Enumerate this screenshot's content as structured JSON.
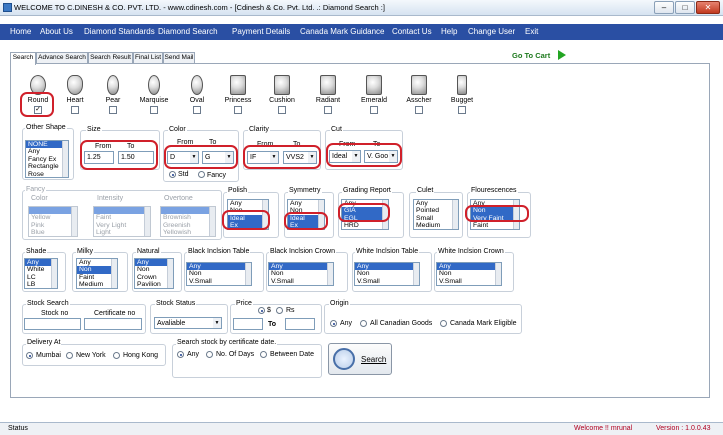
{
  "window": {
    "title": "WELCOME TO C.DINESH & CO. PVT. LTD. - www.cdinesh.com - [Cdinesh & Co. Pvt. Ltd. .: Diamond Search :]"
  },
  "menu": [
    "Home",
    "About Us",
    "Diamond Standards",
    "Diamond Search",
    "Payment Details",
    "Canada Mark Guidance",
    "Contact Us",
    "Help",
    "Change User",
    "Exit"
  ],
  "tabs": [
    "Search",
    "Advance Search",
    "Search Result",
    "Final List",
    "Send Mail"
  ],
  "go_to_cart": "Go To Cart",
  "shapes": [
    {
      "label": "Round",
      "checked": true
    },
    {
      "label": "Heart",
      "checked": false
    },
    {
      "label": "Pear",
      "checked": false
    },
    {
      "label": "Marquise",
      "checked": false
    },
    {
      "label": "Oval",
      "checked": false
    },
    {
      "label": "Princess",
      "checked": false
    },
    {
      "label": "Cushion",
      "checked": false
    },
    {
      "label": "Radiant",
      "checked": false
    },
    {
      "label": "Emerald",
      "checked": false
    },
    {
      "label": "Asscher",
      "checked": false
    },
    {
      "label": "Bugget",
      "checked": false
    }
  ],
  "other_shape": {
    "label": "Other Shape",
    "items": [
      "NONE",
      "Any",
      "Fancy Ex",
      "Rectangle",
      "Rose"
    ],
    "selected": 0
  },
  "size": {
    "label": "Size",
    "from_label": "From",
    "to_label": "To",
    "from": "1.25",
    "to": "1.50"
  },
  "color": {
    "label": "Color",
    "from_label": "From",
    "to_label": "To",
    "from": "D",
    "to": "G",
    "opt_std": "Std",
    "opt_fancy": "Fancy"
  },
  "clarity": {
    "label": "Clarity",
    "from_label": "From",
    "to_label": "To",
    "from": "IF",
    "to": "VVS2"
  },
  "cut": {
    "label": "Cut",
    "from_label": "From",
    "to_label": "To",
    "from": "Ideal",
    "to": "V. Goo"
  },
  "fancy": {
    "label": "Fancy",
    "sub_color": "Color",
    "color_items": [
      "",
      "Yellow",
      "Pink",
      "Blue"
    ],
    "sub_intensity": "Intensity",
    "intensity_items": [
      "",
      "Faint",
      "Very Light",
      "Light"
    ],
    "sub_overtone": "Overtone",
    "overtone_items": [
      "",
      "Brownish",
      "Greenish",
      "Yellowish"
    ]
  },
  "polish": {
    "label": "Polish",
    "items": [
      "Any",
      "Non",
      "Ideal",
      "Ex"
    ],
    "selected": [
      2,
      3
    ]
  },
  "symmetry": {
    "label": "Symmetry",
    "items": [
      "Any",
      "Non",
      "Ideal",
      "Ex"
    ],
    "selected": [
      2,
      3
    ]
  },
  "grading_report": {
    "label": "Grading Report",
    "items": [
      "Any",
      "GIA",
      "EGL",
      "HRD"
    ],
    "selected": [
      1,
      2
    ]
  },
  "culet": {
    "label": "Culet",
    "items": [
      "Any",
      "Pointed",
      "Small",
      "Medium"
    ],
    "selected": []
  },
  "flourescence": {
    "label": "Flourescences",
    "items": [
      "Any",
      "Non",
      "Very Faint",
      "Faint"
    ],
    "selected": [
      1,
      2
    ]
  },
  "shade": {
    "label": "Shade",
    "items": [
      "Any",
      "White",
      "LC",
      "LB"
    ],
    "selected": [
      0
    ]
  },
  "milky": {
    "label": "Milky",
    "items": [
      "Any",
      "Non",
      "Faint",
      "Medium"
    ],
    "selected": [
      1
    ]
  },
  "natural": {
    "label": "Natural",
    "items": [
      "Any",
      "Non",
      "Crown",
      "Pavilion"
    ],
    "selected": [
      0
    ]
  },
  "black_table": {
    "label": "Black Inclsion Table",
    "items": [
      "Any",
      "Non",
      "V.Small"
    ],
    "selected": [
      0
    ]
  },
  "black_crown": {
    "label": "Black Inclsion Crown",
    "items": [
      "Any",
      "Non",
      "V.Small"
    ],
    "selected": [
      0
    ]
  },
  "white_table": {
    "label": "White Inclsion Table",
    "items": [
      "Any",
      "Non",
      "V.Small"
    ],
    "selected": [
      0
    ]
  },
  "white_crown": {
    "label": "White Inclsion Crown",
    "items": [
      "Any",
      "Non",
      "V.Small"
    ],
    "selected": [
      0
    ]
  },
  "stock_search": {
    "label": "Stock Search",
    "stock_no_label": "Stock no",
    "cert_no_label": "Certificate no"
  },
  "stock_status": {
    "label": "Stock Status",
    "value": "Avaliable"
  },
  "price": {
    "label": "Price",
    "opt_usd": "$",
    "opt_rs": "Rs",
    "to_label": "To"
  },
  "origin": {
    "label": "Origin",
    "options": [
      "Any",
      "All Canadian Goods",
      "Canada Mark Eligible"
    ],
    "selected": 0
  },
  "delivery": {
    "label": "Delivery At",
    "options": [
      "Mumbai",
      "New York",
      "Hong Kong"
    ],
    "selected": 0
  },
  "cert_date": {
    "label": "Search stock by certificate date.",
    "options": [
      "Any",
      "No. Of Days",
      "Between Date"
    ],
    "selected": 0
  },
  "search_button": "Search",
  "status": {
    "label": "Status",
    "welcome": "Welcome !! mrunal",
    "version": "Version : 1.0.0.43"
  },
  "colors": {
    "menu_bg": "#2a4fa3",
    "selection": "#3169c6",
    "highlight_border": "#d0202a",
    "status_text": "#b00020"
  }
}
